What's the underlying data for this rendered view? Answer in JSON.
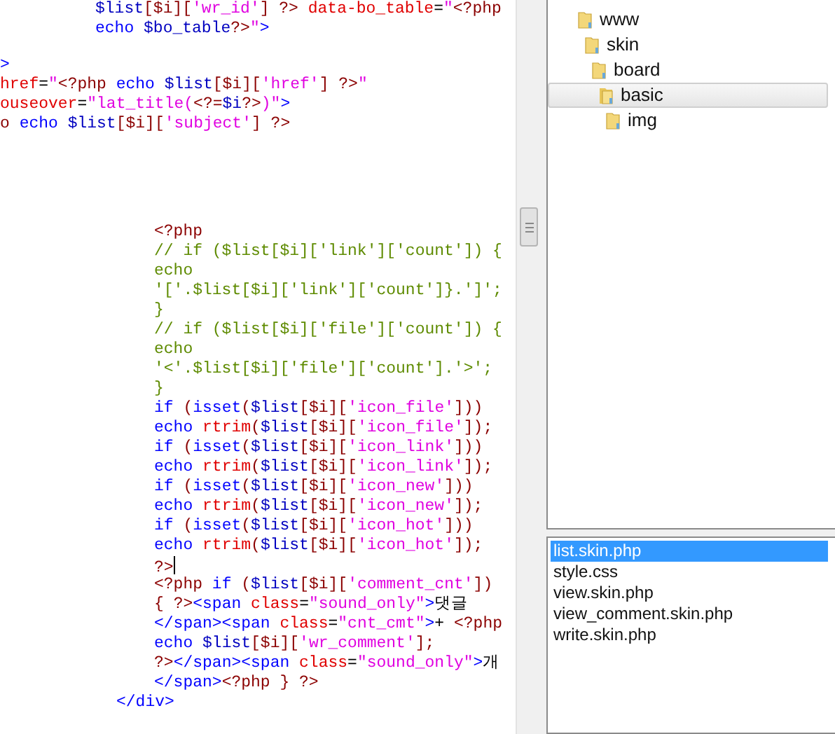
{
  "editor": {
    "sections": [
      {
        "kind": "indented",
        "lines": [
          {
            "tokens": [
              {
                "kind": "variable",
                "text": "$list"
              },
              {
                "kind": "punct",
                "text": "[$i]["
              },
              {
                "kind": "string",
                "text": "'wr_id'"
              },
              {
                "kind": "punct",
                "text": "]"
              },
              {
                "kind": "tag",
                "text": " ?> "
              },
              {
                "kind": "attr",
                "text": "data-bo_table"
              },
              {
                "kind": "plain",
                "text": "="
              },
              {
                "kind": "string",
                "text": "\""
              },
              {
                "kind": "tag",
                "text": "<?php"
              }
            ]
          },
          {
            "tokens": [
              {
                "kind": "keyword",
                "text": "echo "
              },
              {
                "kind": "variable",
                "text": "$bo_table"
              },
              {
                "kind": "tag",
                "text": "?>"
              },
              {
                "kind": "string",
                "text": "\""
              },
              {
                "kind": "html",
                "text": ">"
              }
            ]
          }
        ]
      },
      {
        "kind": "cut",
        "lines": [
          {
            "tokens": [
              {
                "kind": "html",
                "text": ">"
              }
            ]
          },
          {
            "tokens": [
              {
                "kind": "attr",
                "text": "href"
              },
              {
                "kind": "plain",
                "text": "="
              },
              {
                "kind": "string",
                "text": "\""
              },
              {
                "kind": "tag",
                "text": "<?php "
              },
              {
                "kind": "keyword",
                "text": "echo "
              },
              {
                "kind": "variable",
                "text": "$list"
              },
              {
                "kind": "punct",
                "text": "[$i]["
              },
              {
                "kind": "string",
                "text": "'href'"
              },
              {
                "kind": "punct",
                "text": "]"
              },
              {
                "kind": "tag",
                "text": " ?>"
              },
              {
                "kind": "string",
                "text": "\""
              }
            ]
          },
          {
            "tokens": [
              {
                "kind": "attr",
                "text": "ouseover"
              },
              {
                "kind": "plain",
                "text": "="
              },
              {
                "kind": "string",
                "text": "\"lat_title("
              },
              {
                "kind": "tag",
                "text": "<?="
              },
              {
                "kind": "variable",
                "text": "$i"
              },
              {
                "kind": "tag",
                "text": "?>"
              },
              {
                "kind": "string",
                "text": ")\""
              },
              {
                "kind": "html",
                "text": ">"
              }
            ]
          },
          {
            "tokens": [
              {
                "kind": "tag",
                "text": "o "
              },
              {
                "kind": "keyword",
                "text": "echo "
              },
              {
                "kind": "variable",
                "text": "$list"
              },
              {
                "kind": "punct",
                "text": "[$i]["
              },
              {
                "kind": "string",
                "text": "'subject'"
              },
              {
                "kind": "punct",
                "text": "]"
              },
              {
                "kind": "tag",
                "text": " ?>"
              }
            ]
          }
        ]
      },
      {
        "kind": "deep",
        "lines": [
          {
            "tokens": [
              {
                "kind": "tag",
                "text": "<?php"
              }
            ]
          },
          {
            "tokens": [
              {
                "kind": "comment",
                "text": "// if ($list[$i]['link']['count']) {"
              }
            ]
          },
          {
            "tokens": [
              {
                "kind": "comment",
                "text": "echo"
              }
            ]
          },
          {
            "tokens": [
              {
                "kind": "comment",
                "text": "'['.$list[$i]['link']['count']}.']';"
              }
            ]
          },
          {
            "tokens": [
              {
                "kind": "comment",
                "text": "}"
              }
            ]
          },
          {
            "tokens": [
              {
                "kind": "comment",
                "text": "// if ($list[$i]['file']['count']) {"
              }
            ]
          },
          {
            "tokens": [
              {
                "kind": "comment",
                "text": "echo"
              }
            ]
          },
          {
            "tokens": [
              {
                "kind": "comment",
                "text": "'<'.$list[$i]['file']['count'].'>';"
              }
            ]
          },
          {
            "tokens": [
              {
                "kind": "comment",
                "text": "}"
              }
            ]
          },
          {
            "tokens": [
              {
                "kind": "keyword",
                "text": "if "
              },
              {
                "kind": "punct",
                "text": "("
              },
              {
                "kind": "keyword",
                "text": "isset"
              },
              {
                "kind": "punct",
                "text": "("
              },
              {
                "kind": "variable",
                "text": "$list"
              },
              {
                "kind": "punct",
                "text": "[$i]["
              },
              {
                "kind": "string",
                "text": "'icon_file'"
              },
              {
                "kind": "punct",
                "text": "]))"
              }
            ]
          },
          {
            "tokens": [
              {
                "kind": "keyword",
                "text": "echo "
              },
              {
                "kind": "function",
                "text": "rtrim"
              },
              {
                "kind": "punct",
                "text": "("
              },
              {
                "kind": "variable",
                "text": "$list"
              },
              {
                "kind": "punct",
                "text": "[$i]["
              },
              {
                "kind": "string",
                "text": "'icon_file'"
              },
              {
                "kind": "punct",
                "text": "]);"
              }
            ]
          },
          {
            "tokens": [
              {
                "kind": "keyword",
                "text": "if "
              },
              {
                "kind": "punct",
                "text": "("
              },
              {
                "kind": "keyword",
                "text": "isset"
              },
              {
                "kind": "punct",
                "text": "("
              },
              {
                "kind": "variable",
                "text": "$list"
              },
              {
                "kind": "punct",
                "text": "[$i]["
              },
              {
                "kind": "string",
                "text": "'icon_link'"
              },
              {
                "kind": "punct",
                "text": "]))"
              }
            ]
          },
          {
            "tokens": [
              {
                "kind": "keyword",
                "text": "echo "
              },
              {
                "kind": "function",
                "text": "rtrim"
              },
              {
                "kind": "punct",
                "text": "("
              },
              {
                "kind": "variable",
                "text": "$list"
              },
              {
                "kind": "punct",
                "text": "[$i]["
              },
              {
                "kind": "string",
                "text": "'icon_link'"
              },
              {
                "kind": "punct",
                "text": "]);"
              }
            ]
          },
          {
            "tokens": [
              {
                "kind": "keyword",
                "text": "if "
              },
              {
                "kind": "punct",
                "text": "("
              },
              {
                "kind": "keyword",
                "text": "isset"
              },
              {
                "kind": "punct",
                "text": "("
              },
              {
                "kind": "variable",
                "text": "$list"
              },
              {
                "kind": "punct",
                "text": "[$i]["
              },
              {
                "kind": "string",
                "text": "'icon_new'"
              },
              {
                "kind": "punct",
                "text": "]))"
              }
            ]
          },
          {
            "tokens": [
              {
                "kind": "keyword",
                "text": "echo "
              },
              {
                "kind": "function",
                "text": "rtrim"
              },
              {
                "kind": "punct",
                "text": "("
              },
              {
                "kind": "variable",
                "text": "$list"
              },
              {
                "kind": "punct",
                "text": "[$i]["
              },
              {
                "kind": "string",
                "text": "'icon_new'"
              },
              {
                "kind": "punct",
                "text": "]);"
              }
            ]
          },
          {
            "tokens": [
              {
                "kind": "keyword",
                "text": "if "
              },
              {
                "kind": "punct",
                "text": "("
              },
              {
                "kind": "keyword",
                "text": "isset"
              },
              {
                "kind": "punct",
                "text": "("
              },
              {
                "kind": "variable",
                "text": "$list"
              },
              {
                "kind": "punct",
                "text": "[$i]["
              },
              {
                "kind": "string",
                "text": "'icon_hot'"
              },
              {
                "kind": "punct",
                "text": "]))"
              }
            ]
          },
          {
            "tokens": [
              {
                "kind": "keyword",
                "text": "echo "
              },
              {
                "kind": "function",
                "text": "rtrim"
              },
              {
                "kind": "punct",
                "text": "("
              },
              {
                "kind": "variable",
                "text": "$list"
              },
              {
                "kind": "punct",
                "text": "[$i]["
              },
              {
                "kind": "string",
                "text": "'icon_hot'"
              },
              {
                "kind": "punct",
                "text": "]);"
              }
            ]
          },
          {
            "tokens": [
              {
                "kind": "tag",
                "text": "?>"
              }
            ],
            "caret": true
          },
          {
            "tokens": [
              {
                "kind": "tag",
                "text": "<?php "
              },
              {
                "kind": "keyword",
                "text": "if "
              },
              {
                "kind": "punct",
                "text": "("
              },
              {
                "kind": "variable",
                "text": "$list"
              },
              {
                "kind": "punct",
                "text": "[$i]["
              },
              {
                "kind": "string",
                "text": "'comment_cnt'"
              },
              {
                "kind": "punct",
                "text": "])"
              }
            ]
          },
          {
            "tokens": [
              {
                "kind": "punct",
                "text": "{ "
              },
              {
                "kind": "tag",
                "text": "?>"
              },
              {
                "kind": "html",
                "text": "<span "
              },
              {
                "kind": "attr",
                "text": "class"
              },
              {
                "kind": "plain",
                "text": "="
              },
              {
                "kind": "string",
                "text": "\"sound_only\""
              },
              {
                "kind": "html",
                "text": ">"
              },
              {
                "kind": "plain",
                "text": "댓글"
              }
            ]
          },
          {
            "tokens": [
              {
                "kind": "html",
                "text": "</span><span "
              },
              {
                "kind": "attr",
                "text": "class"
              },
              {
                "kind": "plain",
                "text": "="
              },
              {
                "kind": "string",
                "text": "\"cnt_cmt\""
              },
              {
                "kind": "html",
                "text": ">"
              },
              {
                "kind": "plain",
                "text": "+ "
              },
              {
                "kind": "tag",
                "text": "<?php"
              }
            ]
          },
          {
            "tokens": [
              {
                "kind": "keyword",
                "text": "echo "
              },
              {
                "kind": "variable",
                "text": "$list"
              },
              {
                "kind": "punct",
                "text": "[$i]["
              },
              {
                "kind": "string",
                "text": "'wr_comment'"
              },
              {
                "kind": "punct",
                "text": "];"
              }
            ]
          },
          {
            "tokens": [
              {
                "kind": "tag",
                "text": "?>"
              },
              {
                "kind": "html",
                "text": "</span><span "
              },
              {
                "kind": "attr",
                "text": "class"
              },
              {
                "kind": "plain",
                "text": "="
              },
              {
                "kind": "string",
                "text": "\"sound_only\""
              },
              {
                "kind": "html",
                "text": ">"
              },
              {
                "kind": "plain",
                "text": "개"
              }
            ]
          },
          {
            "tokens": [
              {
                "kind": "html",
                "text": "</span>"
              },
              {
                "kind": "tag",
                "text": "<?php } ?>"
              }
            ]
          }
        ]
      },
      {
        "kind": "mid",
        "lines": [
          {
            "tokens": [
              {
                "kind": "html",
                "text": "</div>"
              }
            ]
          }
        ]
      }
    ]
  },
  "folder_tree": {
    "items": [
      {
        "label": "www",
        "selected": false,
        "children": [
          {
            "label": "skin",
            "selected": false,
            "children": [
              {
                "label": "board",
                "selected": false,
                "children": [
                  {
                    "label": "basic",
                    "selected": true,
                    "children": [
                      {
                        "label": "img",
                        "selected": false
                      }
                    ]
                  }
                ]
              }
            ]
          }
        ]
      }
    ]
  },
  "file_list": {
    "items": [
      {
        "label": "list.skin.php",
        "selected": true
      },
      {
        "label": "style.css",
        "selected": false
      },
      {
        "label": "view.skin.php",
        "selected": false
      },
      {
        "label": "view_comment.skin.php",
        "selected": false
      },
      {
        "label": "write.skin.php",
        "selected": false
      }
    ]
  }
}
